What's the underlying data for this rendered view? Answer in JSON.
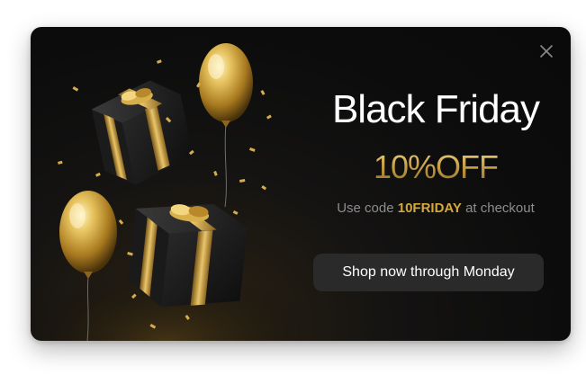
{
  "popup": {
    "title": "Black Friday",
    "offer": "10%OFF",
    "code_prefix": "Use code",
    "code": "10FRIDAY",
    "code_suffix": "at checkout",
    "cta_label": "Shop now through Monday",
    "close_icon": "close-icon"
  },
  "colors": {
    "background": "#0c0c0c",
    "title": "#ffffff",
    "gold": "#caa247",
    "code_text": "#d4a83c",
    "muted_text": "#8d8d8d",
    "button_bg": "#2a2a2a"
  },
  "illustration": {
    "subject": "gold balloons and black gift boxes with gold ribbons and confetti"
  }
}
